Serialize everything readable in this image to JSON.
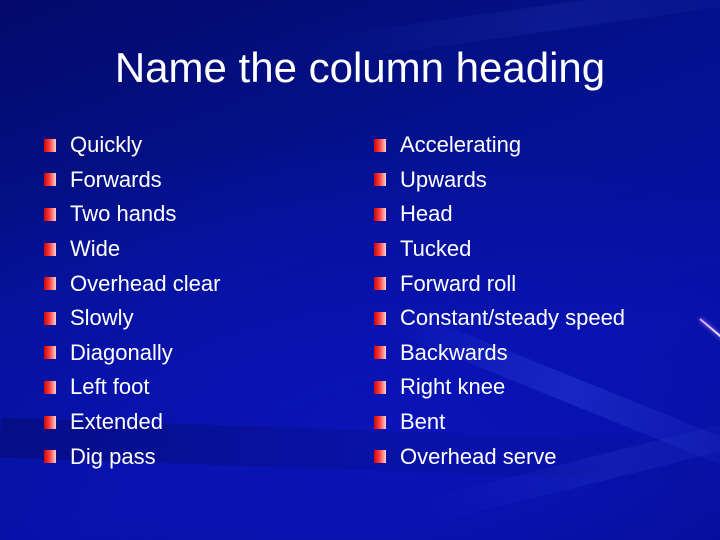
{
  "slide": {
    "title": "Name the column heading",
    "bullet_color": "#e8201e",
    "background_color": "#05089a",
    "left_column": {
      "items": [
        "Quickly",
        "Forwards",
        "Two hands",
        "Wide",
        "Overhead clear",
        "Slowly",
        "Diagonally",
        "Left foot",
        "Extended",
        "Dig pass"
      ]
    },
    "right_column": {
      "items": [
        "Accelerating",
        "Upwards",
        "Head",
        "Tucked",
        "Forward roll",
        "Constant/steady speed",
        "Backwards",
        "Right knee",
        "Bent",
        "Overhead serve"
      ]
    }
  }
}
